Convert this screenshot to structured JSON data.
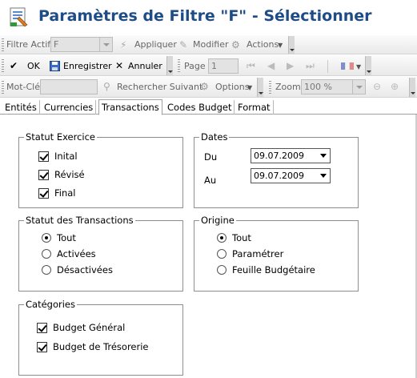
{
  "window": {
    "title": "Paramètres de Filtre \"F\" - Sélectionner",
    "icon": "filter-settings-icon"
  },
  "toolbar1": {
    "filter_label": "Filtre Actif",
    "filter_value": "F",
    "apply_label": "Appliquer",
    "modify_label": "Modifier",
    "actions_label": "Actions"
  },
  "toolbar2": {
    "ok_label": "OK",
    "save_label": "Enregistrer",
    "cancel_label": "Annuler",
    "page_label": "Page",
    "page_value": "1"
  },
  "toolbar3": {
    "keyword_label": "Mot-Clé",
    "keyword_value": "",
    "search_next_label": "Rechercher Suivant",
    "options_label": "Options",
    "zoom_label": "Zoom",
    "zoom_value": "100 %"
  },
  "tabs": [
    {
      "label": "Entités",
      "active": false
    },
    {
      "label": "Currencies",
      "active": false
    },
    {
      "label": "Transactions",
      "active": true
    },
    {
      "label": "Codes Budget",
      "active": false
    },
    {
      "label": "Format",
      "active": false
    }
  ],
  "statut_exercice": {
    "title": "Statut Exercice",
    "items": [
      {
        "label": "Inital",
        "checked": true
      },
      {
        "label": "Révisé",
        "checked": true
      },
      {
        "label": "Final",
        "checked": true
      }
    ]
  },
  "dates": {
    "title": "Dates",
    "from_label": "Du",
    "from_value": "09.07.2009",
    "to_label": "Au",
    "to_value": "09.07.2009"
  },
  "statut_transactions": {
    "title": "Statut des Transactions",
    "items": [
      {
        "label": "Tout",
        "checked": true
      },
      {
        "label": "Activées",
        "checked": false
      },
      {
        "label": "Désactivées",
        "checked": false
      }
    ]
  },
  "origine": {
    "title": "Origine",
    "items": [
      {
        "label": "Tout",
        "checked": true
      },
      {
        "label": "Paramétrer",
        "checked": false
      },
      {
        "label": "Feuille Budgétaire",
        "checked": false
      }
    ]
  },
  "categories": {
    "title": "Catégories",
    "items": [
      {
        "label": "Budget Général",
        "checked": true
      },
      {
        "label": "Budget de Trésorerie",
        "checked": true
      }
    ]
  },
  "colors": {
    "title": "#1e4c86",
    "toolbar_bg": "#ececec",
    "group_border": "#8e8e8e"
  }
}
